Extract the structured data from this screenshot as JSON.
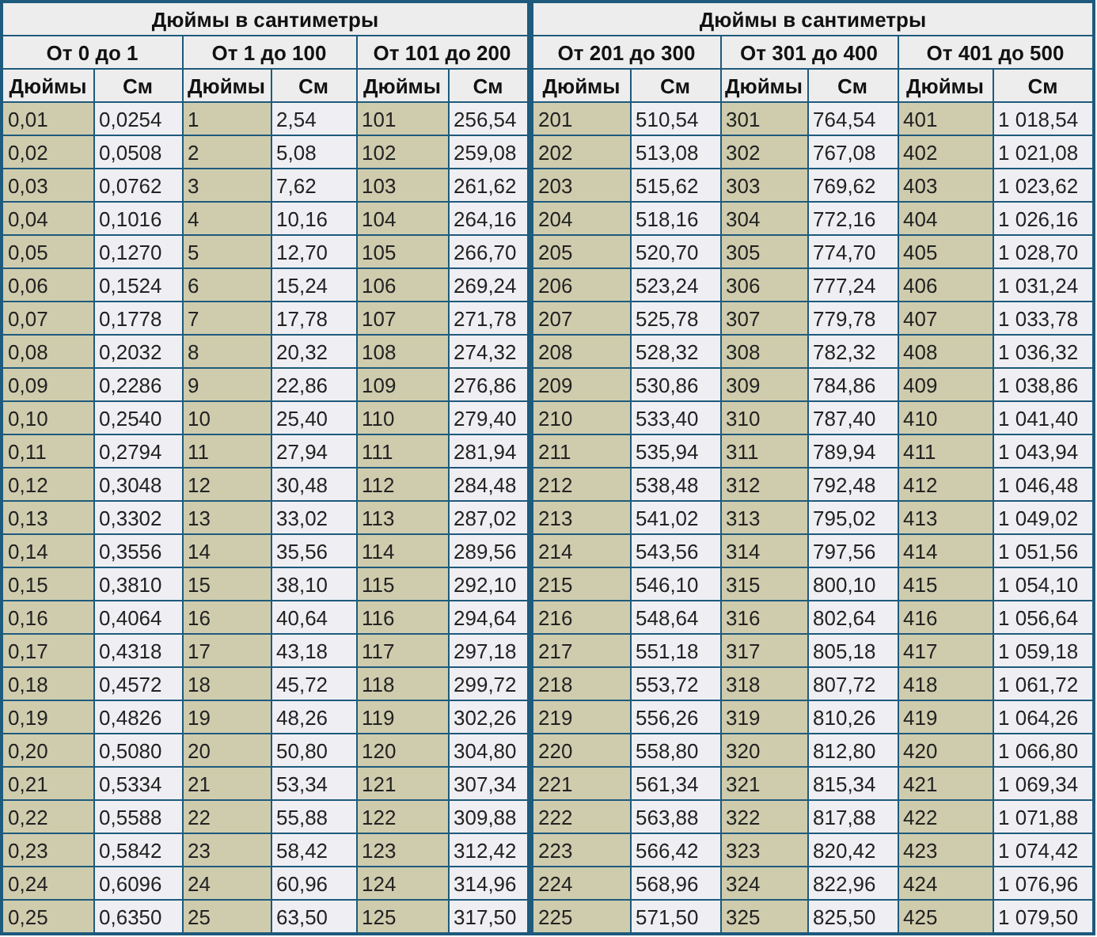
{
  "tables": [
    {
      "title": "Дюймы в сантиметры",
      "groups": [
        "От 0 до 1",
        "От 1 до 100",
        "От 101 до 200"
      ],
      "columns": [
        {
          "label": "Дюймы",
          "kind": "inches"
        },
        {
          "label": "См",
          "kind": "cm"
        },
        {
          "label": "Дюймы",
          "kind": "inches"
        },
        {
          "label": "См",
          "kind": "cm"
        },
        {
          "label": "Дюймы",
          "kind": "inches"
        },
        {
          "label": "См",
          "kind": "cm"
        }
      ],
      "rows": [
        [
          "0,01",
          "0,0254",
          "1",
          "2,54",
          "101",
          "256,54"
        ],
        [
          "0,02",
          "0,0508",
          "2",
          "5,08",
          "102",
          "259,08"
        ],
        [
          "0,03",
          "0,0762",
          "3",
          "7,62",
          "103",
          "261,62"
        ],
        [
          "0,04",
          "0,1016",
          "4",
          "10,16",
          "104",
          "264,16"
        ],
        [
          "0,05",
          "0,1270",
          "5",
          "12,70",
          "105",
          "266,70"
        ],
        [
          "0,06",
          "0,1524",
          "6",
          "15,24",
          "106",
          "269,24"
        ],
        [
          "0,07",
          "0,1778",
          "7",
          "17,78",
          "107",
          "271,78"
        ],
        [
          "0,08",
          "0,2032",
          "8",
          "20,32",
          "108",
          "274,32"
        ],
        [
          "0,09",
          "0,2286",
          "9",
          "22,86",
          "109",
          "276,86"
        ],
        [
          "0,10",
          "0,2540",
          "10",
          "25,40",
          "110",
          "279,40"
        ],
        [
          "0,11",
          "0,2794",
          "11",
          "27,94",
          "111",
          "281,94"
        ],
        [
          "0,12",
          "0,3048",
          "12",
          "30,48",
          "112",
          "284,48"
        ],
        [
          "0,13",
          "0,3302",
          "13",
          "33,02",
          "113",
          "287,02"
        ],
        [
          "0,14",
          "0,3556",
          "14",
          "35,56",
          "114",
          "289,56"
        ],
        [
          "0,15",
          "0,3810",
          "15",
          "38,10",
          "115",
          "292,10"
        ],
        [
          "0,16",
          "0,4064",
          "16",
          "40,64",
          "116",
          "294,64"
        ],
        [
          "0,17",
          "0,4318",
          "17",
          "43,18",
          "117",
          "297,18"
        ],
        [
          "0,18",
          "0,4572",
          "18",
          "45,72",
          "118",
          "299,72"
        ],
        [
          "0,19",
          "0,4826",
          "19",
          "48,26",
          "119",
          "302,26"
        ],
        [
          "0,20",
          "0,5080",
          "20",
          "50,80",
          "120",
          "304,80"
        ],
        [
          "0,21",
          "0,5334",
          "21",
          "53,34",
          "121",
          "307,34"
        ],
        [
          "0,22",
          "0,5588",
          "22",
          "55,88",
          "122",
          "309,88"
        ],
        [
          "0,23",
          "0,5842",
          "23",
          "58,42",
          "123",
          "312,42"
        ],
        [
          "0,24",
          "0,6096",
          "24",
          "60,96",
          "124",
          "314,96"
        ],
        [
          "0,25",
          "0,6350",
          "25",
          "63,50",
          "125",
          "317,50"
        ]
      ]
    },
    {
      "title": "Дюймы в сантиметры",
      "groups": [
        "От 201 до 300",
        "От 301 до 400",
        "От 401 до 500"
      ],
      "columns": [
        {
          "label": "Дюймы",
          "kind": "inches"
        },
        {
          "label": "См",
          "kind": "cm"
        },
        {
          "label": "Дюймы",
          "kind": "inches"
        },
        {
          "label": "См",
          "kind": "cm"
        },
        {
          "label": "Дюймы",
          "kind": "inches"
        },
        {
          "label": "См",
          "kind": "cm"
        }
      ],
      "rows": [
        [
          "201",
          "510,54",
          "301",
          "764,54",
          "401",
          "1 018,54"
        ],
        [
          "202",
          "513,08",
          "302",
          "767,08",
          "402",
          "1 021,08"
        ],
        [
          "203",
          "515,62",
          "303",
          "769,62",
          "403",
          "1 023,62"
        ],
        [
          "204",
          "518,16",
          "304",
          "772,16",
          "404",
          "1 026,16"
        ],
        [
          "205",
          "520,70",
          "305",
          "774,70",
          "405",
          "1 028,70"
        ],
        [
          "206",
          "523,24",
          "306",
          "777,24",
          "406",
          "1 031,24"
        ],
        [
          "207",
          "525,78",
          "307",
          "779,78",
          "407",
          "1 033,78"
        ],
        [
          "208",
          "528,32",
          "308",
          "782,32",
          "408",
          "1 036,32"
        ],
        [
          "209",
          "530,86",
          "309",
          "784,86",
          "409",
          "1 038,86"
        ],
        [
          "210",
          "533,40",
          "310",
          "787,40",
          "410",
          "1 041,40"
        ],
        [
          "211",
          "535,94",
          "311",
          "789,94",
          "411",
          "1 043,94"
        ],
        [
          "212",
          "538,48",
          "312",
          "792,48",
          "412",
          "1 046,48"
        ],
        [
          "213",
          "541,02",
          "313",
          "795,02",
          "413",
          "1 049,02"
        ],
        [
          "214",
          "543,56",
          "314",
          "797,56",
          "414",
          "1 051,56"
        ],
        [
          "215",
          "546,10",
          "315",
          "800,10",
          "415",
          "1 054,10"
        ],
        [
          "216",
          "548,64",
          "316",
          "802,64",
          "416",
          "1 056,64"
        ],
        [
          "217",
          "551,18",
          "317",
          "805,18",
          "417",
          "1 059,18"
        ],
        [
          "218",
          "553,72",
          "318",
          "807,72",
          "418",
          "1 061,72"
        ],
        [
          "219",
          "556,26",
          "319",
          "810,26",
          "419",
          "1 064,26"
        ],
        [
          "220",
          "558,80",
          "320",
          "812,80",
          "420",
          "1 066,80"
        ],
        [
          "221",
          "561,34",
          "321",
          "815,34",
          "421",
          "1 069,34"
        ],
        [
          "222",
          "563,88",
          "322",
          "817,88",
          "422",
          "1 071,88"
        ],
        [
          "223",
          "566,42",
          "323",
          "820,42",
          "423",
          "1 074,42"
        ],
        [
          "224",
          "568,96",
          "324",
          "822,96",
          "424",
          "1 076,96"
        ],
        [
          "225",
          "571,50",
          "325",
          "825,50",
          "425",
          "1 079,50"
        ]
      ]
    }
  ]
}
